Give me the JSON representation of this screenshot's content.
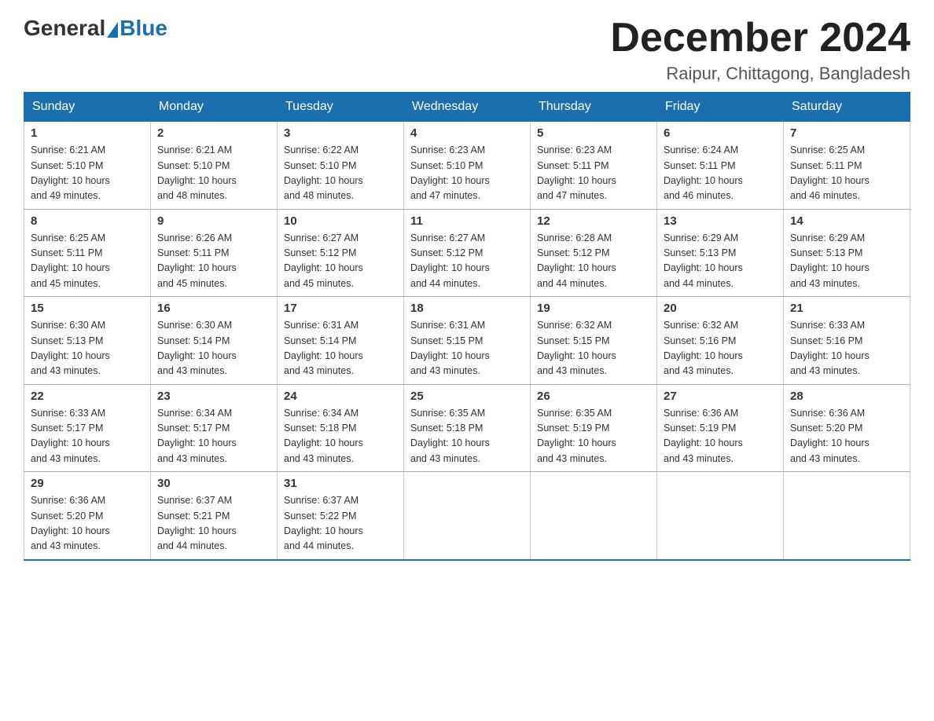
{
  "header": {
    "logo_general": "General",
    "logo_blue": "Blue",
    "month_title": "December 2024",
    "location": "Raipur, Chittagong, Bangladesh"
  },
  "days_of_week": [
    "Sunday",
    "Monday",
    "Tuesday",
    "Wednesday",
    "Thursday",
    "Friday",
    "Saturday"
  ],
  "weeks": [
    [
      {
        "day": "1",
        "sunrise": "6:21 AM",
        "sunset": "5:10 PM",
        "daylight": "10 hours and 49 minutes."
      },
      {
        "day": "2",
        "sunrise": "6:21 AM",
        "sunset": "5:10 PM",
        "daylight": "10 hours and 48 minutes."
      },
      {
        "day": "3",
        "sunrise": "6:22 AM",
        "sunset": "5:10 PM",
        "daylight": "10 hours and 48 minutes."
      },
      {
        "day": "4",
        "sunrise": "6:23 AM",
        "sunset": "5:10 PM",
        "daylight": "10 hours and 47 minutes."
      },
      {
        "day": "5",
        "sunrise": "6:23 AM",
        "sunset": "5:11 PM",
        "daylight": "10 hours and 47 minutes."
      },
      {
        "day": "6",
        "sunrise": "6:24 AM",
        "sunset": "5:11 PM",
        "daylight": "10 hours and 46 minutes."
      },
      {
        "day": "7",
        "sunrise": "6:25 AM",
        "sunset": "5:11 PM",
        "daylight": "10 hours and 46 minutes."
      }
    ],
    [
      {
        "day": "8",
        "sunrise": "6:25 AM",
        "sunset": "5:11 PM",
        "daylight": "10 hours and 45 minutes."
      },
      {
        "day": "9",
        "sunrise": "6:26 AM",
        "sunset": "5:11 PM",
        "daylight": "10 hours and 45 minutes."
      },
      {
        "day": "10",
        "sunrise": "6:27 AM",
        "sunset": "5:12 PM",
        "daylight": "10 hours and 45 minutes."
      },
      {
        "day": "11",
        "sunrise": "6:27 AM",
        "sunset": "5:12 PM",
        "daylight": "10 hours and 44 minutes."
      },
      {
        "day": "12",
        "sunrise": "6:28 AM",
        "sunset": "5:12 PM",
        "daylight": "10 hours and 44 minutes."
      },
      {
        "day": "13",
        "sunrise": "6:29 AM",
        "sunset": "5:13 PM",
        "daylight": "10 hours and 44 minutes."
      },
      {
        "day": "14",
        "sunrise": "6:29 AM",
        "sunset": "5:13 PM",
        "daylight": "10 hours and 43 minutes."
      }
    ],
    [
      {
        "day": "15",
        "sunrise": "6:30 AM",
        "sunset": "5:13 PM",
        "daylight": "10 hours and 43 minutes."
      },
      {
        "day": "16",
        "sunrise": "6:30 AM",
        "sunset": "5:14 PM",
        "daylight": "10 hours and 43 minutes."
      },
      {
        "day": "17",
        "sunrise": "6:31 AM",
        "sunset": "5:14 PM",
        "daylight": "10 hours and 43 minutes."
      },
      {
        "day": "18",
        "sunrise": "6:31 AM",
        "sunset": "5:15 PM",
        "daylight": "10 hours and 43 minutes."
      },
      {
        "day": "19",
        "sunrise": "6:32 AM",
        "sunset": "5:15 PM",
        "daylight": "10 hours and 43 minutes."
      },
      {
        "day": "20",
        "sunrise": "6:32 AM",
        "sunset": "5:16 PM",
        "daylight": "10 hours and 43 minutes."
      },
      {
        "day": "21",
        "sunrise": "6:33 AM",
        "sunset": "5:16 PM",
        "daylight": "10 hours and 43 minutes."
      }
    ],
    [
      {
        "day": "22",
        "sunrise": "6:33 AM",
        "sunset": "5:17 PM",
        "daylight": "10 hours and 43 minutes."
      },
      {
        "day": "23",
        "sunrise": "6:34 AM",
        "sunset": "5:17 PM",
        "daylight": "10 hours and 43 minutes."
      },
      {
        "day": "24",
        "sunrise": "6:34 AM",
        "sunset": "5:18 PM",
        "daylight": "10 hours and 43 minutes."
      },
      {
        "day": "25",
        "sunrise": "6:35 AM",
        "sunset": "5:18 PM",
        "daylight": "10 hours and 43 minutes."
      },
      {
        "day": "26",
        "sunrise": "6:35 AM",
        "sunset": "5:19 PM",
        "daylight": "10 hours and 43 minutes."
      },
      {
        "day": "27",
        "sunrise": "6:36 AM",
        "sunset": "5:19 PM",
        "daylight": "10 hours and 43 minutes."
      },
      {
        "day": "28",
        "sunrise": "6:36 AM",
        "sunset": "5:20 PM",
        "daylight": "10 hours and 43 minutes."
      }
    ],
    [
      {
        "day": "29",
        "sunrise": "6:36 AM",
        "sunset": "5:20 PM",
        "daylight": "10 hours and 43 minutes."
      },
      {
        "day": "30",
        "sunrise": "6:37 AM",
        "sunset": "5:21 PM",
        "daylight": "10 hours and 44 minutes."
      },
      {
        "day": "31",
        "sunrise": "6:37 AM",
        "sunset": "5:22 PM",
        "daylight": "10 hours and 44 minutes."
      },
      null,
      null,
      null,
      null
    ]
  ],
  "labels": {
    "sunrise_prefix": "Sunrise: ",
    "sunset_prefix": "Sunset: ",
    "daylight_prefix": "Daylight: "
  }
}
